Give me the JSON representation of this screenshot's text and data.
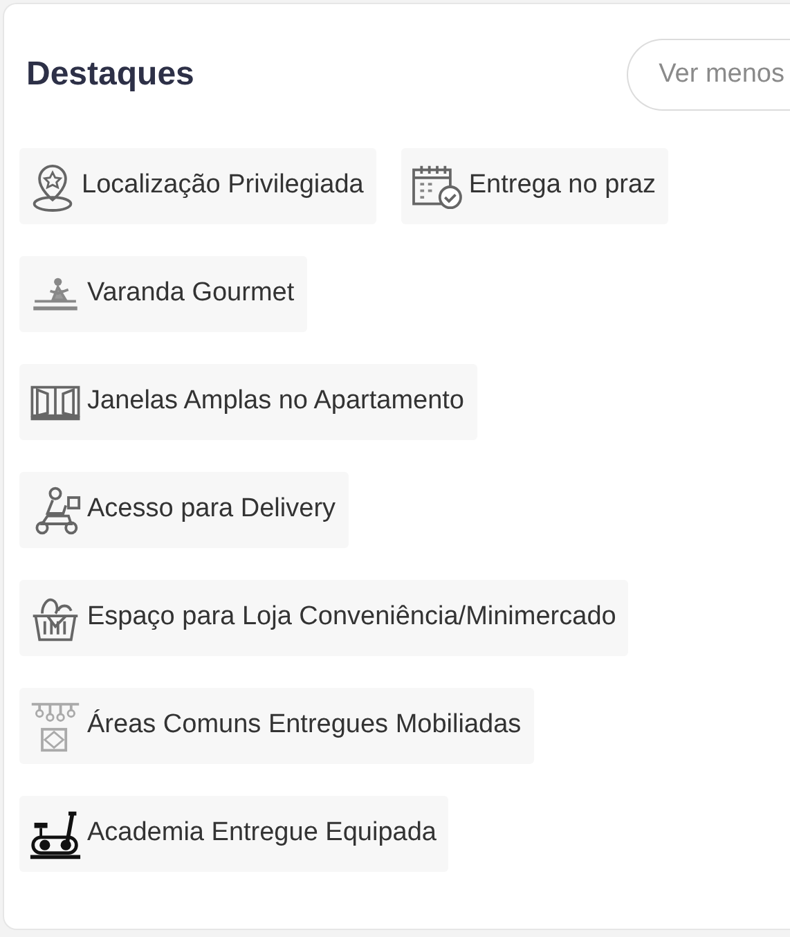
{
  "section": {
    "title": "Destaques",
    "toggle_button": "Ver menos"
  },
  "highlights": [
    {
      "kind": "location",
      "label": "Localização Privilegiada"
    },
    {
      "kind": "calendar",
      "label": "Entrega no praz"
    },
    {
      "kind": "balcony",
      "label": "Varanda Gourmet"
    },
    {
      "kind": "window",
      "label": "Janelas Amplas no Apartamento"
    },
    {
      "kind": "delivery",
      "label": "Acesso para Delivery"
    },
    {
      "kind": "market",
      "label": "Espaço para Loja Conveniência/Minimercado"
    },
    {
      "kind": "furnished",
      "label": "Áreas Comuns Entregues Mobiliadas"
    },
    {
      "kind": "gym",
      "label": "Academia Entregue Equipada"
    }
  ]
}
